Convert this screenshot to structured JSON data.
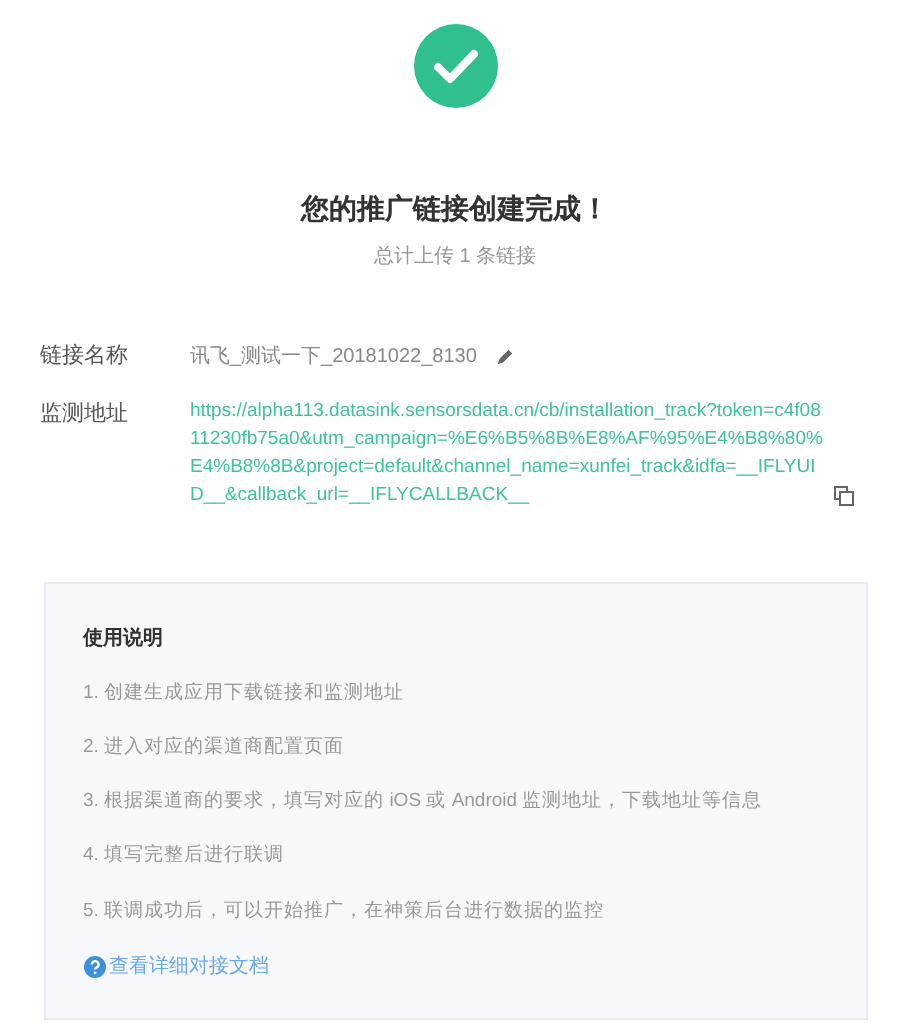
{
  "title": "您的推广链接创建完成！",
  "subtitle": "总计上传 1 条链接",
  "fields": [
    {
      "kind": "name",
      "label": "链接名称",
      "value": "讯飞_测试一下_20181022_8130"
    },
    {
      "kind": "url",
      "label": "监测地址",
      "value": "https://alpha113.datasink.sensorsdata.cn/cb/installation_track?token=c4f0811230fb75a0&utm_campaign=%E6%B5%8B%E8%AF%95%E4%B8%80%E4%B8%8B&project=default&channel_name=xunfei_track&idfa=__IFLYUID__&callback_url=__IFLYCALLBACK__"
    }
  ],
  "instructions": {
    "heading": "使用说明",
    "steps": [
      "1. 创建生成应用下载链接和监测地址",
      "2. 进入对应的渠道商配置页面",
      "3. 根据渠道商的要求，填写对应的 iOS 或 Android 监测地址，下载地址等信息",
      "4. 填写完整后进行联调",
      "5. 联调成功后，可以开始推广，在神策后台进行数据的监控"
    ],
    "link": "查看详细对接文档"
  }
}
